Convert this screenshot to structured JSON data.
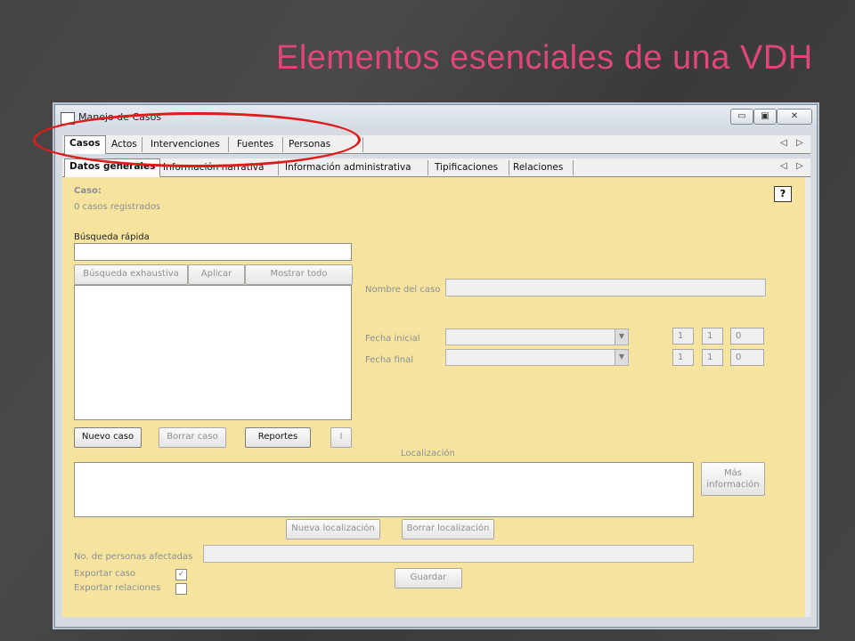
{
  "slide": {
    "title": "Elementos esenciales de una VDH"
  },
  "window": {
    "title": "Manejo de Casos",
    "controls": {
      "minimize": "▭",
      "restore": "▣",
      "close": "✕"
    }
  },
  "main_tabs": [
    "Casos",
    "Actos",
    "Intervenciones",
    "Fuentes",
    "Personas"
  ],
  "sub_tabs": [
    "Datos generales",
    "Información narrativa",
    "Información administrativa",
    "Tipificaciones",
    "Relaciones"
  ],
  "tab_arrows": {
    "left": "◁",
    "right": "▷"
  },
  "panel": {
    "caso_label": "Caso:",
    "casos_count": "0 casos registrados",
    "busqueda_rapida_label": "Búsqueda rápida",
    "busqueda_rapida_value": "",
    "buttons_search": [
      "Búsqueda exhaustiva",
      "Aplicar",
      "Mostrar todo"
    ],
    "nombre_caso_label": "Nombre del caso",
    "nombre_caso_value": "",
    "fecha_inicial_label": "Fecha inicial",
    "fecha_final_label": "Fecha final",
    "fecha_inicial_parts": [
      "1",
      "1",
      "0"
    ],
    "fecha_final_parts": [
      "1",
      "1",
      "0"
    ],
    "combo_arrow": "▼",
    "buttons_case": [
      "Nuevo caso",
      "Borrar caso",
      "Reportes",
      "I"
    ],
    "localizacion_label": "Localización",
    "mas_informacion": "Más información",
    "buttons_loc": [
      "Nueva localización",
      "Borrar localización"
    ],
    "personas_afectadas_label": "No. de personas afectadas",
    "personas_afectadas_value": "",
    "exportar_caso_label": "Exportar caso",
    "exportar_caso_checked": true,
    "exportar_relaciones_label": "Exportar relaciones",
    "exportar_relaciones_checked": false,
    "check_mark": "✓",
    "guardar": "Guardar",
    "help": "?"
  },
  "colors": {
    "title": "#e0457b",
    "panel_bg": "#f6e39e",
    "highlight": "#e01b1b"
  }
}
